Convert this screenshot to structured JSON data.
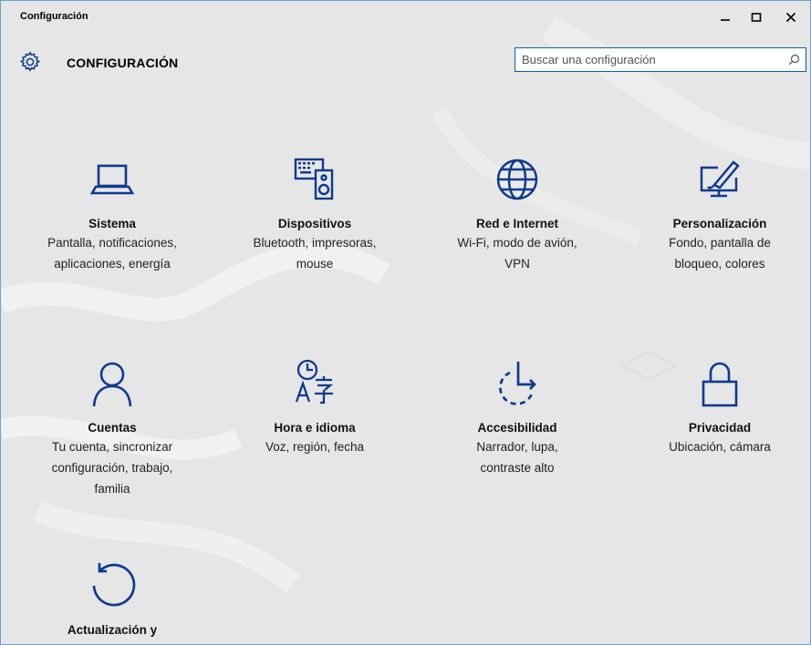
{
  "window": {
    "title": "Configuración"
  },
  "header": {
    "title": "CONFIGURACIÓN",
    "search_placeholder": "Buscar una configuración"
  },
  "colors": {
    "accent": "#0e3a8c",
    "search_border": "#0c5fae",
    "background": "#e6e6e6"
  },
  "tiles": [
    {
      "icon": "laptop-icon",
      "title": "Sistema",
      "subtitle": "Pantalla, notificaciones,\naplicaciones, energía"
    },
    {
      "icon": "devices-icon",
      "title": "Dispositivos",
      "subtitle": "Bluetooth, impresoras,\nmouse"
    },
    {
      "icon": "globe-icon",
      "title": "Red e Internet",
      "subtitle": "Wi-Fi, modo de avión,\nVPN"
    },
    {
      "icon": "personalization-icon",
      "title": "Personalización",
      "subtitle": "Fondo, pantalla de\nbloqueo, colores"
    },
    {
      "icon": "person-icon",
      "title": "Cuentas",
      "subtitle": "Tu cuenta, sincronizar\nconfiguración, trabajo,\nfamilia"
    },
    {
      "icon": "time-language-icon",
      "title": "Hora e idioma",
      "subtitle": "Voz, región, fecha"
    },
    {
      "icon": "accessibility-icon",
      "title": "Accesibilidad",
      "subtitle": "Narrador, lupa,\ncontraste alto"
    },
    {
      "icon": "lock-icon",
      "title": "Privacidad",
      "subtitle": "Ubicación, cámara"
    },
    {
      "icon": "update-icon",
      "title": "Actualización y",
      "subtitle": ""
    }
  ]
}
